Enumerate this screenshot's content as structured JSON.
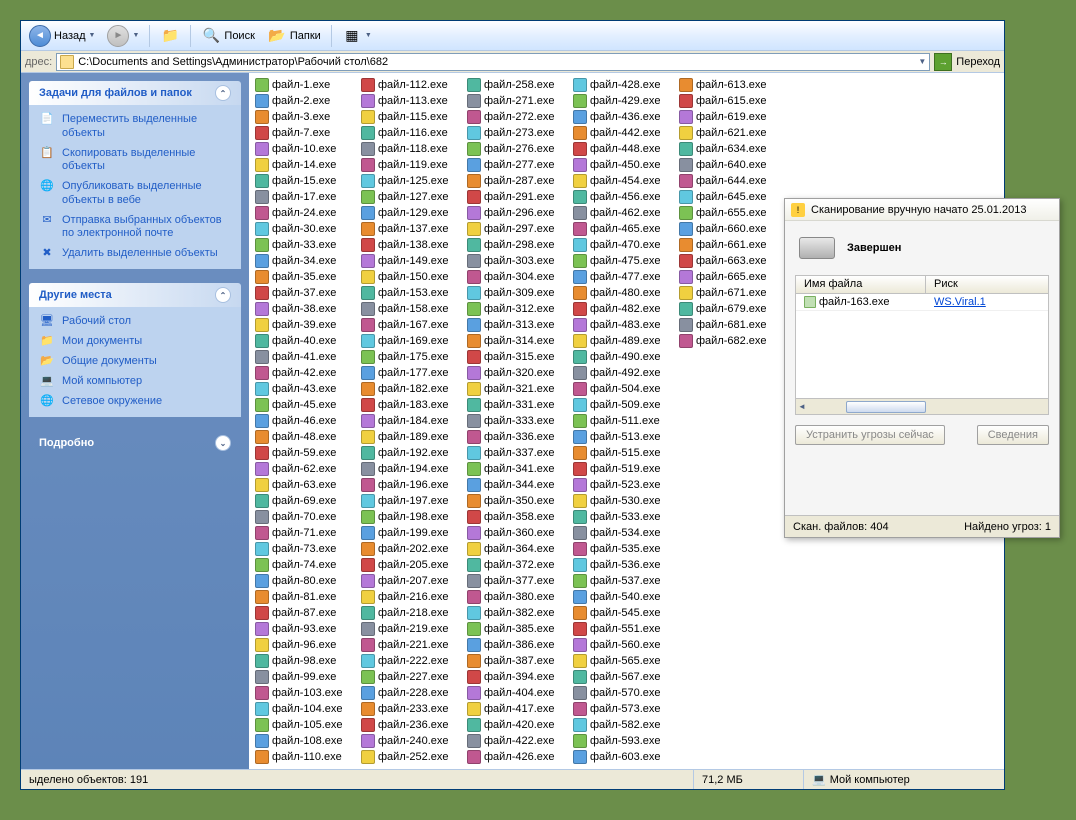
{
  "toolbar": {
    "back": "Назад",
    "search": "Поиск",
    "folders": "Папки"
  },
  "address": {
    "label": "дрес:",
    "path": "C:\\Documents and Settings\\Администратор\\Рабочий стол\\682",
    "go": "Переход"
  },
  "sidebar": {
    "tasks_title": "Задачи для файлов и папок",
    "tasks": [
      {
        "icon": "📄",
        "label": "Переместить выделенные объекты"
      },
      {
        "icon": "📋",
        "label": "Скопировать выделенные объекты"
      },
      {
        "icon": "🌐",
        "label": "Опубликовать выделенные объекты в вебе"
      },
      {
        "icon": "✉",
        "label": "Отправка выбранных объектов по электронной почте"
      },
      {
        "icon": "✖",
        "label": "Удалить выделенные объекты"
      }
    ],
    "places_title": "Другие места",
    "places": [
      {
        "icon": "🖥",
        "label": "Рабочий стол"
      },
      {
        "icon": "📁",
        "label": "Мои документы"
      },
      {
        "icon": "📂",
        "label": "Общие документы"
      },
      {
        "icon": "💻",
        "label": "Мой компьютер"
      },
      {
        "icon": "🌐",
        "label": "Сетевое окружение"
      }
    ],
    "details_title": "Подробно"
  },
  "files": [
    "файл-1.exe",
    "файл-2.exe",
    "файл-3.exe",
    "файл-7.exe",
    "файл-10.exe",
    "файл-14.exe",
    "файл-15.exe",
    "файл-17.exe",
    "файл-24.exe",
    "файл-30.exe",
    "файл-33.exe",
    "файл-34.exe",
    "файл-35.exe",
    "файл-37.exe",
    "файл-38.exe",
    "файл-39.exe",
    "файл-40.exe",
    "файл-41.exe",
    "файл-42.exe",
    "файл-43.exe",
    "файл-45.exe",
    "файл-46.exe",
    "файл-48.exe",
    "файл-59.exe",
    "файл-62.exe",
    "файл-63.exe",
    "файл-69.exe",
    "файл-70.exe",
    "файл-71.exe",
    "файл-73.exe",
    "файл-74.exe",
    "файл-80.exe",
    "файл-81.exe",
    "файл-87.exe",
    "файл-93.exe",
    "файл-96.exe",
    "файл-98.exe",
    "файл-99.exe",
    "файл-103.exe",
    "файл-104.exe",
    "файл-105.exe",
    "файл-108.exe",
    "файл-110.exe",
    "файл-112.exe",
    "файл-113.exe",
    "файл-115.exe",
    "файл-116.exe",
    "файл-118.exe",
    "файл-119.exe",
    "файл-125.exe",
    "файл-127.exe",
    "файл-129.exe",
    "файл-137.exe",
    "файл-138.exe",
    "файл-149.exe",
    "файл-150.exe",
    "файл-153.exe",
    "файл-158.exe",
    "файл-167.exe",
    "файл-169.exe",
    "файл-175.exe",
    "файл-177.exe",
    "файл-182.exe",
    "файл-183.exe",
    "файл-184.exe",
    "файл-189.exe",
    "файл-192.exe",
    "файл-194.exe",
    "файл-196.exe",
    "файл-197.exe",
    "файл-198.exe",
    "файл-199.exe",
    "файл-202.exe",
    "файл-205.exe",
    "файл-207.exe",
    "файл-216.exe",
    "файл-218.exe",
    "файл-219.exe",
    "файл-221.exe",
    "файл-222.exe",
    "файл-227.exe",
    "файл-228.exe",
    "файл-233.exe",
    "файл-236.exe",
    "файл-240.exe",
    "файл-252.exe",
    "файл-258.exe",
    "файл-271.exe",
    "файл-272.exe",
    "файл-273.exe",
    "файл-276.exe",
    "файл-277.exe",
    "файл-287.exe",
    "файл-291.exe",
    "файл-296.exe",
    "файл-297.exe",
    "файл-298.exe",
    "файл-303.exe",
    "файл-304.exe",
    "файл-309.exe",
    "файл-312.exe",
    "файл-313.exe",
    "файл-314.exe",
    "файл-315.exe",
    "файл-320.exe",
    "файл-321.exe",
    "файл-331.exe",
    "файл-333.exe",
    "файл-336.exe",
    "файл-337.exe",
    "файл-341.exe",
    "файл-344.exe",
    "файл-350.exe",
    "файл-358.exe",
    "файл-360.exe",
    "файл-364.exe",
    "файл-372.exe",
    "файл-377.exe",
    "файл-380.exe",
    "файл-382.exe",
    "файл-385.exe",
    "файл-386.exe",
    "файл-387.exe",
    "файл-394.exe",
    "файл-404.exe",
    "файл-417.exe",
    "файл-420.exe",
    "файл-422.exe",
    "файл-426.exe",
    "файл-428.exe",
    "файл-429.exe",
    "файл-436.exe",
    "файл-442.exe",
    "файл-448.exe",
    "файл-450.exe",
    "файл-454.exe",
    "файл-456.exe",
    "файл-462.exe",
    "файл-465.exe",
    "файл-470.exe",
    "файл-475.exe",
    "файл-477.exe",
    "файл-480.exe",
    "файл-482.exe",
    "файл-483.exe",
    "файл-489.exe",
    "файл-490.exe",
    "файл-492.exe",
    "файл-504.exe",
    "файл-509.exe",
    "файл-511.exe",
    "файл-513.exe",
    "файл-515.exe",
    "файл-519.exe",
    "файл-523.exe",
    "файл-530.exe",
    "файл-533.exe",
    "файл-534.exe",
    "файл-535.exe",
    "файл-536.exe",
    "файл-537.exe",
    "файл-540.exe",
    "файл-545.exe",
    "файл-551.exe",
    "файл-560.exe",
    "файл-565.exe",
    "файл-567.exe",
    "файл-570.exe",
    "файл-573.exe",
    "файл-582.exe",
    "файл-593.exe",
    "файл-603.exe",
    "файл-613.exe",
    "файл-615.exe",
    "файл-619.exe",
    "файл-621.exe",
    "файл-634.exe",
    "файл-640.exe",
    "файл-644.exe",
    "файл-645.exe",
    "файл-655.exe",
    "файл-660.exe",
    "файл-661.exe",
    "файл-663.exe",
    "файл-665.exe",
    "файл-671.exe",
    "файл-679.exe",
    "файл-681.exe",
    "файл-682.exe"
  ],
  "icon_colors": [
    "#7cc254",
    "#5aa0e0",
    "#e88c30",
    "#d04848",
    "#b478d8",
    "#f0d040",
    "#50b8a0",
    "#8890a0",
    "#c05890",
    "#60c8e0"
  ],
  "statusbar": {
    "selected": "ыделено объектов: 191",
    "size": "71,2 МБ",
    "location": "Мой компьютер"
  },
  "scanner": {
    "title": "Сканирование вручную начато 25.01.2013",
    "status": "Завершен",
    "col_filename": "Имя файла",
    "col_risk": "Риск",
    "result_file": "файл-163.exe",
    "result_risk": "WS.Viral.1",
    "btn_fix": "Устранить угрозы сейчас",
    "btn_details": "Сведения",
    "footer_scanned": "Скан. файлов: 404",
    "footer_found": "Найдено угроз: 1"
  }
}
